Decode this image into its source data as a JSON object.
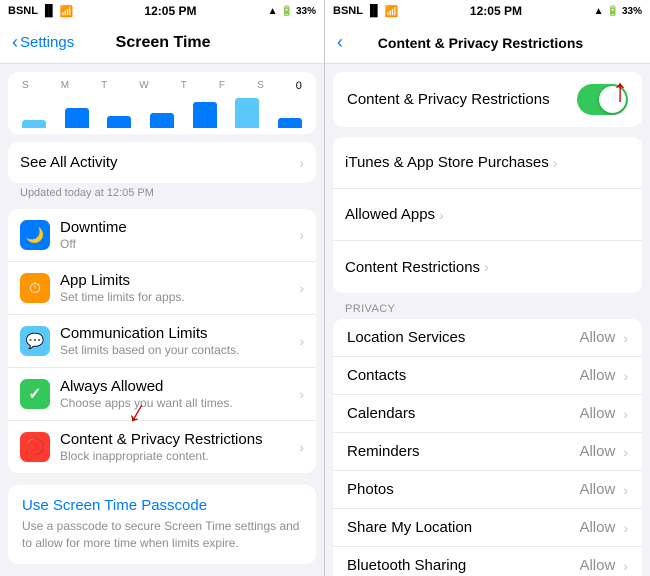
{
  "left": {
    "statusBar": {
      "carrier": "BSNL",
      "time": "12:05 PM",
      "battery": "33%"
    },
    "navTitle": "Screen Time",
    "backLabel": "Settings",
    "seeAllActivity": "See All Activity",
    "updatedText": "Updated today at 12:05 PM",
    "chartDays": [
      "S",
      "M",
      "T",
      "W",
      "T",
      "F",
      "S"
    ],
    "chartBars": [
      4,
      14,
      8,
      10,
      18,
      22,
      6
    ],
    "items": [
      {
        "id": "downtime",
        "iconColor": "icon-blue",
        "icon": "🌙",
        "title": "Downtime",
        "subtitle": "Off"
      },
      {
        "id": "app-limits",
        "iconColor": "icon-orange",
        "icon": "⏱",
        "title": "App Limits",
        "subtitle": "Set time limits for apps."
      },
      {
        "id": "comm-limits",
        "iconColor": "icon-teal",
        "icon": "💬",
        "title": "Communication Limits",
        "subtitle": "Set limits based on your contacts."
      },
      {
        "id": "always-allowed",
        "iconColor": "icon-green",
        "icon": "✓",
        "title": "Always Allowed",
        "subtitle": "Choose apps you want all times."
      },
      {
        "id": "content-privacy",
        "iconColor": "icon-red",
        "icon": "🚫",
        "title": "Content & Privacy Restrictions",
        "subtitle": "Block inappropriate content."
      }
    ],
    "passcodeTitle": "Use Screen Time Passcode",
    "passcodeDesc": "Use a passcode to secure Screen Time settings and to allow for more time when limits expire."
  },
  "right": {
    "statusBar": {
      "carrier": "BSNL",
      "time": "12:05 PM",
      "battery": "33%"
    },
    "navTitle": "Content & Privacy Restrictions",
    "backLabel": "",
    "toggleLabel": "Content & Privacy Restrictions",
    "toggleOn": true,
    "menuItems": [
      {
        "id": "itunes",
        "title": "iTunes & App Store Purchases"
      },
      {
        "id": "allowed-apps",
        "title": "Allowed Apps"
      },
      {
        "id": "content-restrictions",
        "title": "Content Restrictions"
      }
    ],
    "privacyHeader": "PRIVACY",
    "privacyItems": [
      {
        "id": "location",
        "title": "Location Services",
        "value": "Allow"
      },
      {
        "id": "contacts",
        "title": "Contacts",
        "value": "Allow"
      },
      {
        "id": "calendars",
        "title": "Calendars",
        "value": "Allow"
      },
      {
        "id": "reminders",
        "title": "Reminders",
        "value": "Allow"
      },
      {
        "id": "photos",
        "title": "Photos",
        "value": "Allow"
      },
      {
        "id": "share-location",
        "title": "Share My Location",
        "value": "Allow"
      },
      {
        "id": "bluetooth",
        "title": "Bluetooth Sharing",
        "value": "Allow"
      }
    ]
  }
}
